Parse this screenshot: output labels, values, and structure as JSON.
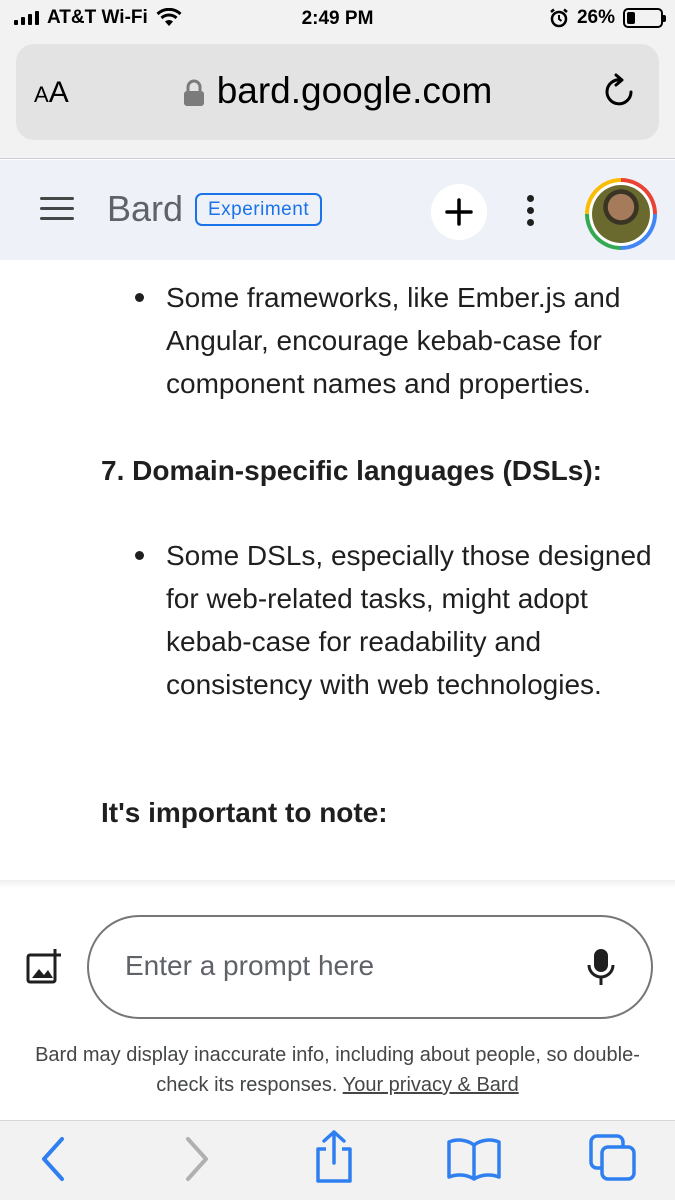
{
  "status_bar": {
    "carrier": "AT&T Wi-Fi",
    "time": "2:49 PM",
    "battery": "26%",
    "battery_level": 0.26,
    "icons": [
      "signal-icon",
      "wifi-icon",
      "alarm-icon",
      "battery-icon"
    ]
  },
  "browser": {
    "text_size_label_small": "A",
    "text_size_label_large": "A",
    "url": "bard.google.com",
    "icons": [
      "lock-icon",
      "reload-icon"
    ]
  },
  "header": {
    "logo": "Bard",
    "badge": "Experiment",
    "icons": [
      "menu-icon",
      "plus-icon",
      "more-vert-icon",
      "avatar"
    ]
  },
  "content": {
    "bullet_1": "Some frameworks, like Ember.js and Angular, encourage kebab-case for component names and properties.",
    "heading_7": "7. Domain-specific languages (DSLs):",
    "bullet_2": "Some DSLs, especially those designed for web-related tasks, might adopt kebab-case for readability and consistency with web technologies.",
    "note_heading": "It's important to note:"
  },
  "prompt": {
    "placeholder": "Enter a prompt here",
    "icons": [
      "add-image-icon",
      "mic-icon"
    ]
  },
  "disclaimer": {
    "text": "Bard may display inaccurate info, including about people, so double-check its responses.",
    "link": "Your privacy & Bard"
  },
  "toolbar": {
    "icons": [
      "back-icon",
      "forward-icon",
      "share-icon",
      "bookmarks-icon",
      "tabs-icon"
    ]
  },
  "colors": {
    "accent": "#1a73e8",
    "header_bg": "#eef2f8",
    "toolbar_blue": "#2f7ff0"
  }
}
